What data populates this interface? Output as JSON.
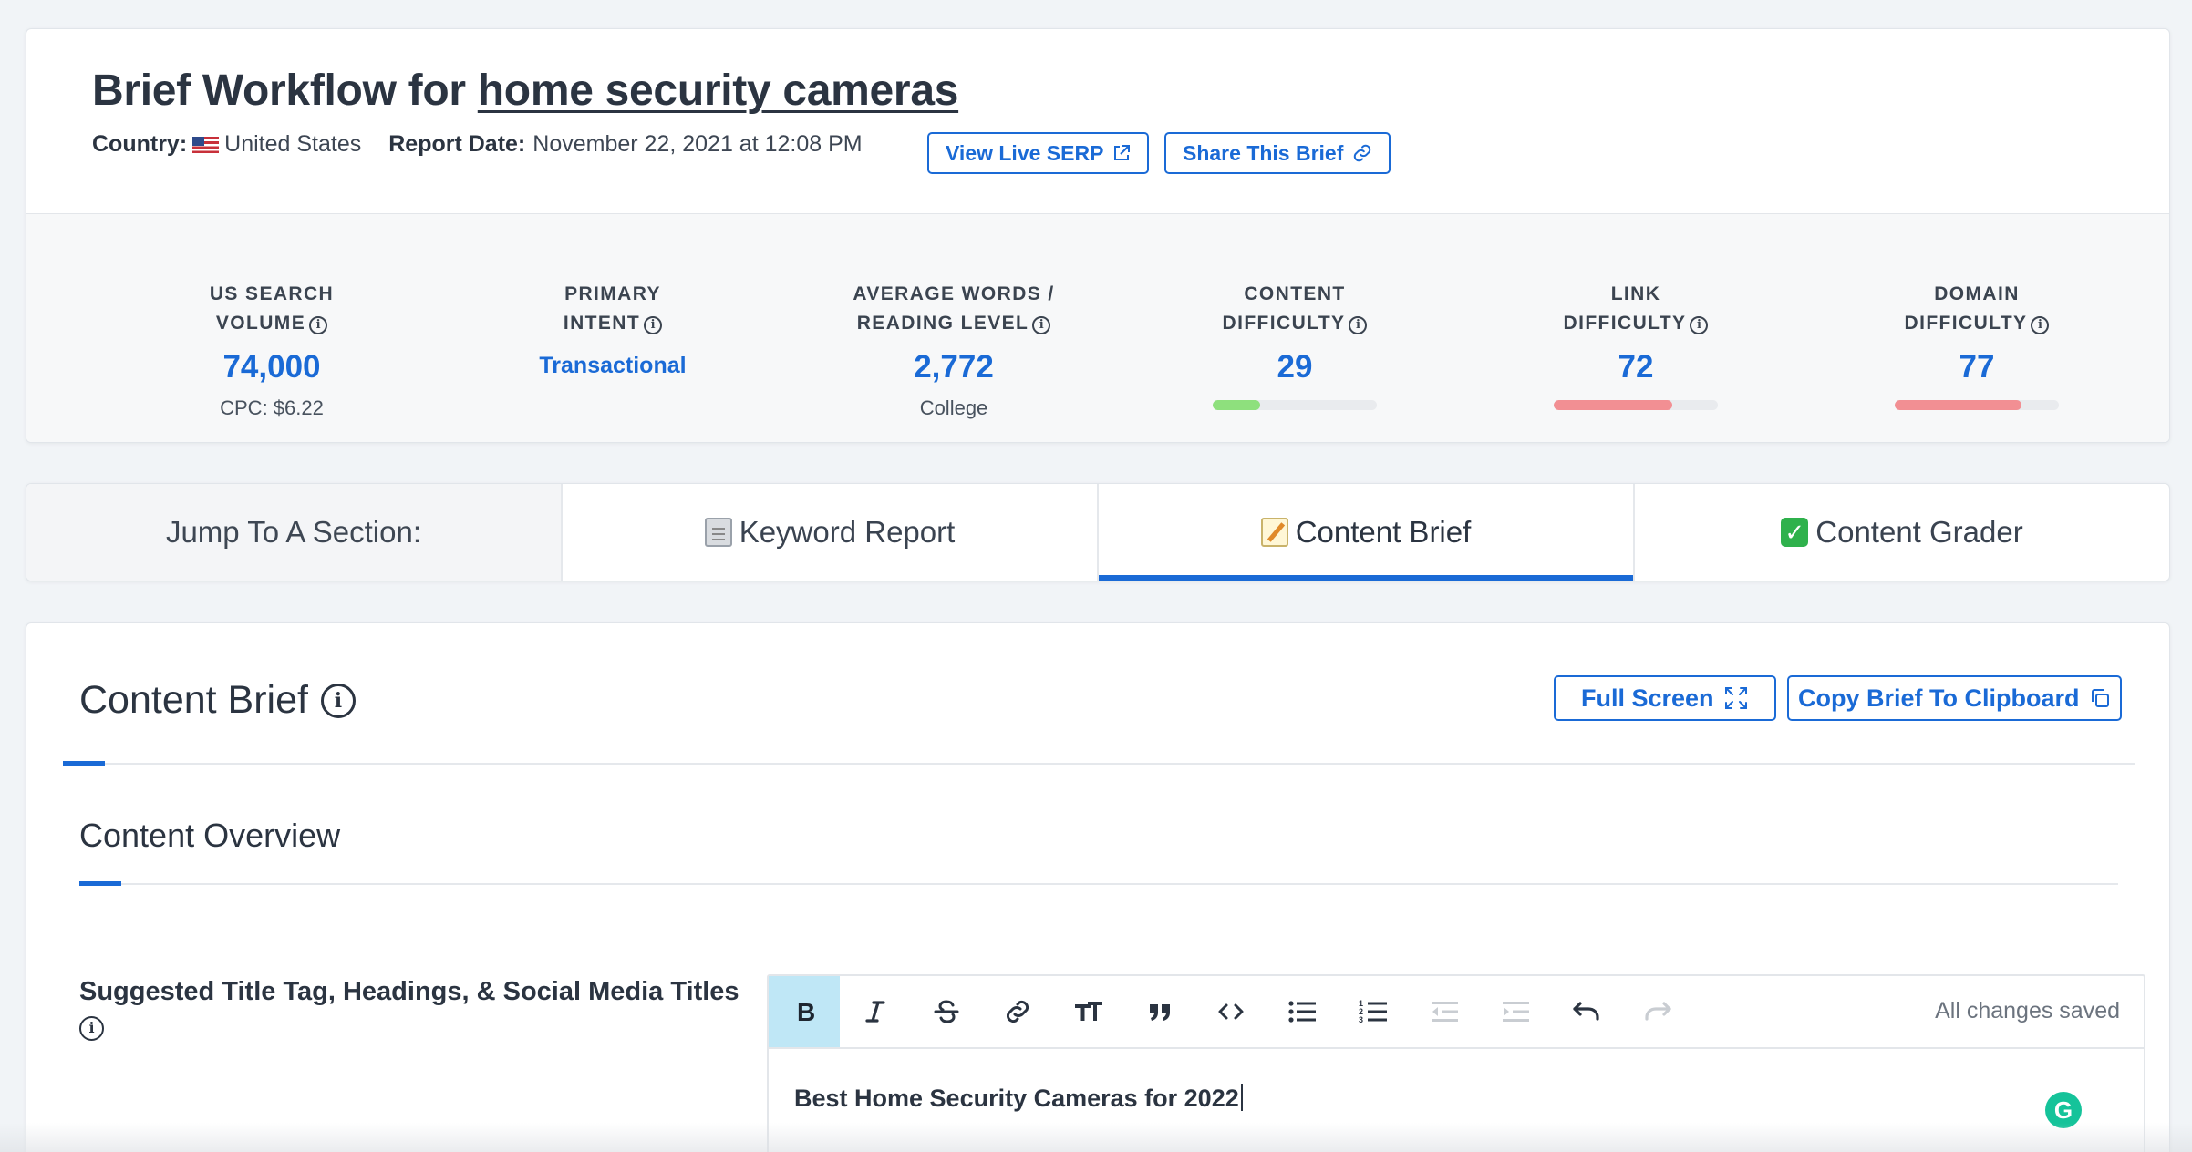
{
  "header": {
    "title_prefix": "Brief Workflow for",
    "title_keyword": "home security cameras",
    "country_label": "Country:",
    "country_value": "United States",
    "report_date_label": "Report Date:",
    "report_date_value": "November 22, 2021 at 12:08 PM",
    "view_serp_label": "View Live SERP",
    "share_label": "Share This Brief"
  },
  "stats": [
    {
      "line1": "US SEARCH",
      "line2": "VOLUME",
      "value": "74,000",
      "sub": "CPC: $6.22"
    },
    {
      "line1": "PRIMARY",
      "line2": "INTENT",
      "value": "Transactional"
    },
    {
      "line1": "AVERAGE WORDS /",
      "line2": "READING LEVEL",
      "value": "2,772",
      "sub": "College"
    },
    {
      "line1": "CONTENT",
      "line2": "DIFFICULTY",
      "value": "29",
      "bar_fraction": 0.29,
      "bar_color": "#8ee07d"
    },
    {
      "line1": "LINK",
      "line2": "DIFFICULTY",
      "value": "72",
      "bar_fraction": 0.72,
      "bar_color": "#f28f93"
    },
    {
      "line1": "DOMAIN",
      "line2": "DIFFICULTY",
      "value": "77",
      "bar_fraction": 0.77,
      "bar_color": "#f28f93"
    }
  ],
  "tabs": {
    "jump_label": "Jump To A Section:",
    "keyword_report": "Keyword Report",
    "content_brief": "Content Brief",
    "content_grader": "Content Grader",
    "active": "content_brief"
  },
  "content": {
    "title": "Content Brief",
    "fullscreen_label": "Full Screen",
    "copy_label": "Copy Brief To Clipboard",
    "overview_title": "Content Overview",
    "suggested_label": "Suggested Title Tag, Headings, & Social Media Titles",
    "editor_text": "Best Home Security Cameras for 2022",
    "save_status": "All changes saved",
    "grammarly_letter": "G"
  },
  "toolbar_icons": [
    "bold-icon",
    "italic-icon",
    "strikethrough-icon",
    "link-icon",
    "text-size-icon",
    "quote-icon",
    "code-icon",
    "bullet-list-icon",
    "numbered-list-icon",
    "outdent-icon",
    "indent-icon",
    "undo-icon",
    "redo-icon"
  ],
  "colors": {
    "accent": "#1a6ad6",
    "active_tool_bg": "#bfe7f6",
    "bar_green": "#8ee07d",
    "bar_red": "#f28f93",
    "grammarly": "#15c39a"
  }
}
